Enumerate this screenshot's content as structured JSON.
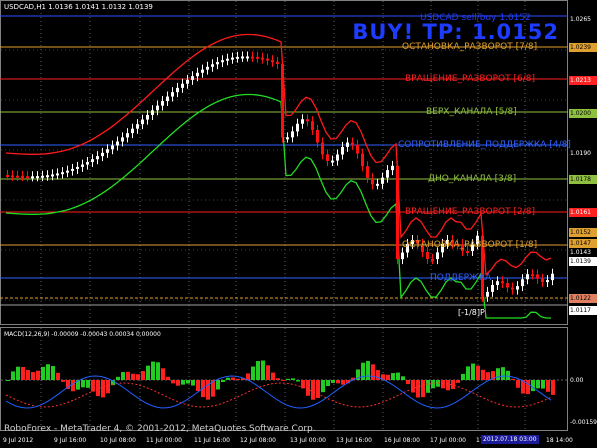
{
  "chart_header": {
    "symbol": "USDCAD,H1",
    "ohlc": "1.0136 1.0141 1.0132 1.0139"
  },
  "signal": {
    "small_text": "USDCAD sell/buy 1.0152",
    "buy_text": "BUY! TP: 1.0152"
  },
  "levels": [
    {
      "label": "ОСТАНОВКА_РАЗВОРОТ [7/8]",
      "color": "#e0a030"
    },
    {
      "label": "ВРАЩЕНИЕ_РАЗВОРОТ [6/8]",
      "color": "#ff2020"
    },
    {
      "label": "ВЕРХ_КАНАЛА [5/8]",
      "color": "#90c040"
    },
    {
      "label": "СОПРОТИВЛЕНИЕ_ПОДДЕРЖКА [4/8]",
      "color": "#3060ff"
    },
    {
      "label": "ДНО_КАНАЛА [3/8]",
      "color": "#90c040"
    },
    {
      "label": "ВРАЩЕНИЕ_РАЗВОРОТ [2/8]",
      "color": "#ff2020"
    },
    {
      "label": "ОСТАНОВКА_РАЗВОРОТ [1/8]",
      "color": "#e0a030"
    },
    {
      "label": "ПОДДЕРЖКА",
      "color": "#3060ff"
    },
    {
      "label": "[-1/8]P",
      "color": "#ffffff"
    }
  ],
  "price_axis": [
    {
      "value": "1.0265",
      "bg": "",
      "fg": "#ffffff"
    },
    {
      "value": "1.0239",
      "bg": "#e0a030",
      "fg": "#000000"
    },
    {
      "value": "1.0213",
      "bg": "#ff2020",
      "fg": "#ffffff"
    },
    {
      "value": "1.0200",
      "bg": "#90c040",
      "fg": "#000000"
    },
    {
      "value": "1.0190",
      "bg": "",
      "fg": "#ffffff"
    },
    {
      "value": "1.0178",
      "bg": "#90c040",
      "fg": "#000000"
    },
    {
      "value": "1.0161",
      "bg": "#ff2020",
      "fg": "#ffffff"
    },
    {
      "value": "1.0152",
      "bg": "#e0a030",
      "fg": "#000000"
    },
    {
      "value": "1.0147",
      "bg": "#e0a030",
      "fg": "#000000"
    },
    {
      "value": "1.0143",
      "bg": "",
      "fg": "#ffffff"
    },
    {
      "value": "1.0139",
      "bg": "#ffffff",
      "fg": "#000000"
    },
    {
      "value": "1.0122",
      "bg": "#e08060",
      "fg": "#000000"
    },
    {
      "value": "1.0117",
      "bg": "#ffffff",
      "fg": "#000000"
    }
  ],
  "macd": {
    "label": "MACD(12,26,9) -0.00009 -0.00043 0.00034 0.00000",
    "axis": [
      "0.00",
      "-0.00159"
    ]
  },
  "copyright": "RoboForex - MetaTrader 4, © 2001-2012, MetaQuotes Software Corp.",
  "time_axis": [
    "9 Jul 2012",
    "9 Jul 16:00",
    "10 Jul 08:00",
    "11 Jul 00:00",
    "11 Jul 16:00",
    "12 Jul 08:00",
    "13 Jul 00:00",
    "13 Jul 16:00",
    "16 Jul 08:00",
    "17 Jul 00:00",
    "17 Jul 16:00"
  ],
  "time_highlight": "2012.07.18 03:00",
  "time_tail": "18 14:00",
  "colors": {
    "bull": "#ffffff",
    "bear": "#ff1010",
    "ma_red": "#ff1a1a",
    "ma_green": "#22dd22",
    "grid": "#606060"
  }
}
